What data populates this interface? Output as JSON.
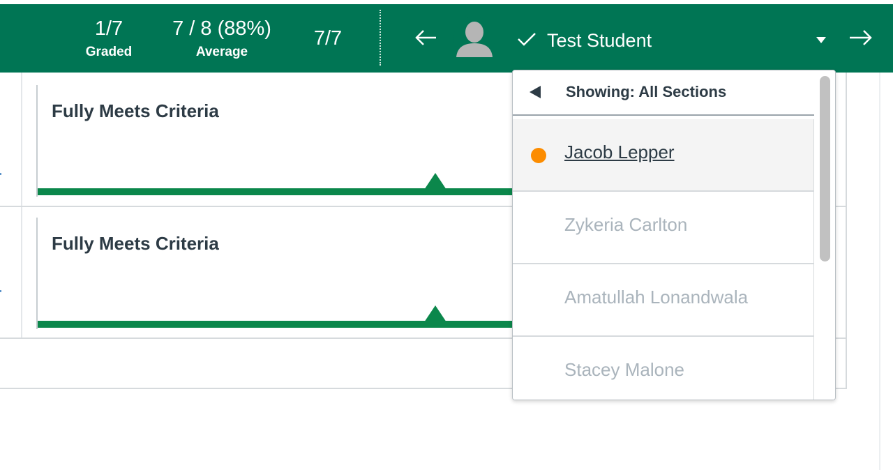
{
  "header": {
    "graded": {
      "value": "1/7",
      "label": "Graded"
    },
    "average": {
      "value": "7 / 8 (88%)",
      "label": "Average"
    },
    "total": {
      "value": "7/7"
    },
    "prev_icon": "arrow-left-icon",
    "next_icon": "arrow-right-icon",
    "avatar_icon": "user-avatar-icon",
    "check_icon": "checkmark-icon",
    "selected_student": "Test Student",
    "dropdown_icon": "caret-down-icon"
  },
  "rubric": {
    "rows": [
      {
        "rating": "Fully Meets Criteria"
      },
      {
        "rating": "Fully Meets Criteria"
      }
    ]
  },
  "dropdown": {
    "section_label": "Showing: All Sections",
    "students": [
      {
        "name": "Jacob Lepper",
        "active": true,
        "status": "orange"
      },
      {
        "name": "Zykeria Carlton",
        "active": false
      },
      {
        "name": "Amatullah Lonandwala",
        "active": false
      },
      {
        "name": "Stacey Malone",
        "active": false
      }
    ]
  },
  "colors": {
    "header_bg": "#007554",
    "rating_green": "#0b874b",
    "status_orange": "#fc8c00"
  }
}
